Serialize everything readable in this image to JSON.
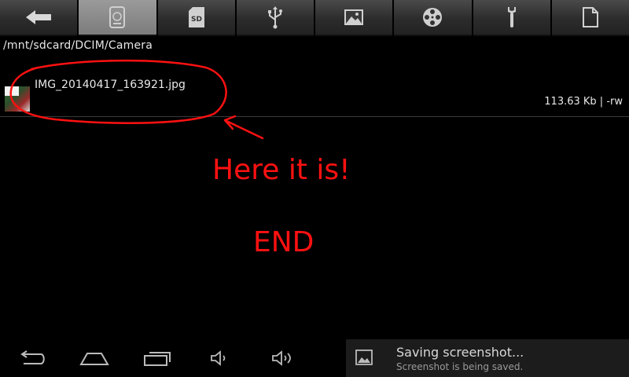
{
  "tabs": [
    {
      "icon": "back-arrow-icon"
    },
    {
      "icon": "internal-storage-icon",
      "active": true
    },
    {
      "icon": "sd-card-icon",
      "label": "SD"
    },
    {
      "icon": "usb-icon"
    },
    {
      "icon": "image-icon"
    },
    {
      "icon": "video-reel-icon"
    },
    {
      "icon": "wrench-icon"
    },
    {
      "icon": "document-icon"
    }
  ],
  "path": "/mnt/sdcard/DCIM/Camera",
  "file": {
    "name": "IMG_20140417_163921.jpg",
    "meta": "113.63 Kb  | -rw"
  },
  "annotations": {
    "arrow_text": "Here it is!",
    "end_text": "END",
    "color": "#ff1111"
  },
  "notification": {
    "title": "Saving screenshot...",
    "subtitle": "Screenshot is being saved."
  },
  "navbar": [
    "back-icon",
    "home-icon",
    "recent-apps-icon",
    "volume-down-icon",
    "volume-up-icon"
  ]
}
